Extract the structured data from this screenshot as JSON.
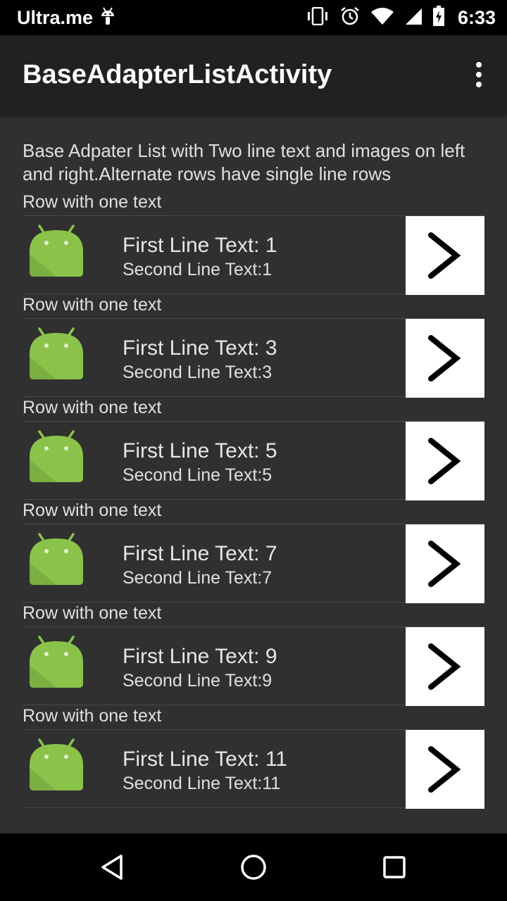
{
  "status_bar": {
    "carrier": "Ultra.me",
    "time": "6:33",
    "icons": [
      "android-notification-icon",
      "vibrate-icon",
      "alarm-icon",
      "wifi-icon",
      "signal-icon",
      "battery-charging-icon"
    ]
  },
  "app_bar": {
    "title": "BaseAdapterListActivity",
    "menu_icon": "overflow-menu-icon"
  },
  "description": "Base Adpater List with Two line text and images on left and right.Alternate rows have single line rows",
  "rows": [
    {
      "header": "Row with one text",
      "first_line": "First Line Text: 1",
      "second_line": "Second Line Text:1"
    },
    {
      "header": "Row with one text",
      "first_line": "First Line Text: 3",
      "second_line": "Second Line Text:3"
    },
    {
      "header": "Row with one text",
      "first_line": "First Line Text: 5",
      "second_line": "Second Line Text:5"
    },
    {
      "header": "Row with one text",
      "first_line": "First Line Text: 7",
      "second_line": "Second Line Text:7"
    },
    {
      "header": "Row with one text",
      "first_line": "First Line Text: 9",
      "second_line": "Second Line Text:9"
    },
    {
      "header": "Row with one text",
      "first_line": "First Line Text: 11",
      "second_line": "Second Line Text:11"
    }
  ],
  "nav_bar": {
    "buttons": [
      "back-icon",
      "home-icon",
      "recents-icon"
    ]
  },
  "colors": {
    "background": "#303030",
    "app_bar": "#212121",
    "android_green": "#8BC34A"
  }
}
